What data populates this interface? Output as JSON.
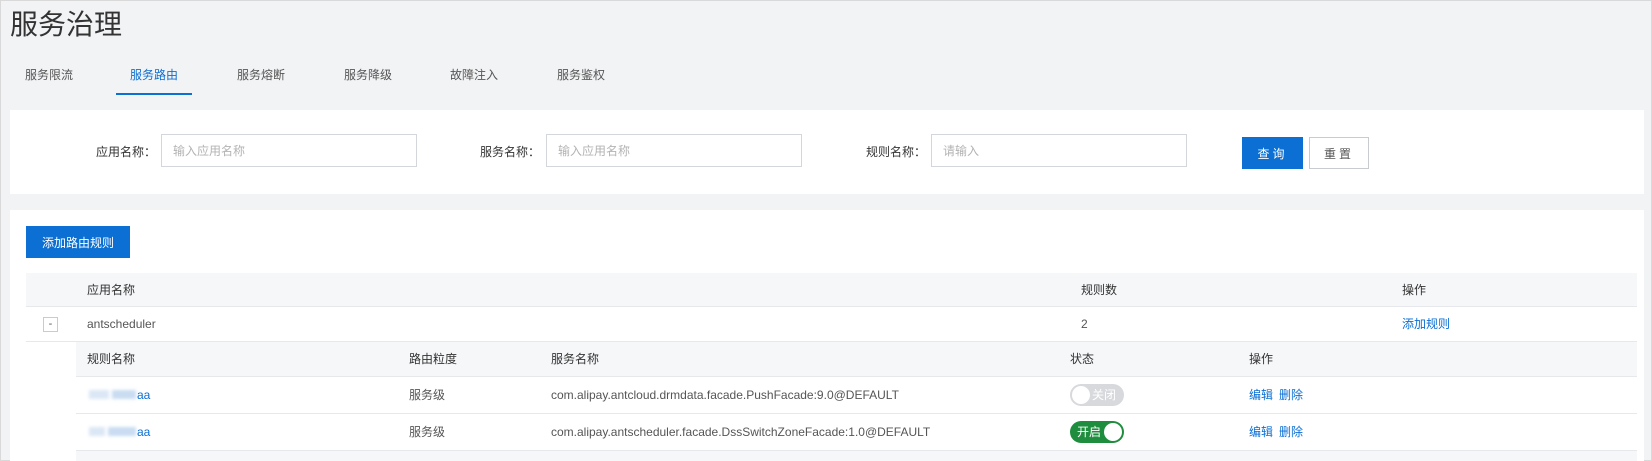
{
  "page": {
    "title": "服务治理"
  },
  "tabs": [
    {
      "label": "服务限流",
      "active": false
    },
    {
      "label": "服务路由",
      "active": true
    },
    {
      "label": "服务熔断",
      "active": false
    },
    {
      "label": "服务降级",
      "active": false
    },
    {
      "label": "故障注入",
      "active": false
    },
    {
      "label": "服务鉴权",
      "active": false
    }
  ],
  "filters": {
    "app_name": {
      "label": "应用名称：",
      "value": "",
      "placeholder": "输入应用名称"
    },
    "service_name": {
      "label": "服务名称：",
      "value": "",
      "placeholder": "输入应用名称"
    },
    "rule_name": {
      "label": "规则名称：",
      "value": "",
      "placeholder": "请输入"
    },
    "query_label": "查询",
    "reset_label": "重置"
  },
  "toolbar": {
    "add_rule_label": "添加路由规则"
  },
  "table": {
    "columns": {
      "app_name": "应用名称",
      "rule_count": "规则数",
      "actions": "操作"
    },
    "rows": [
      {
        "expand_symbol": "-",
        "app_name": "antscheduler",
        "rule_count": "2",
        "action": "添加规则"
      }
    ]
  },
  "sub_table": {
    "columns": {
      "rule_name": "规则名称",
      "granularity": "路由粒度",
      "service_name": "服务名称",
      "status": "状态",
      "actions": "操作"
    },
    "rows": [
      {
        "rule_name_suffix": "aa",
        "granularity": "服务级",
        "service_name": "com.alipay.antcloud.drmdata.facade.PushFacade:9.0@DEFAULT",
        "status": "off",
        "status_label": "关闭",
        "edit": "编辑",
        "delete": "删除"
      },
      {
        "rule_name_suffix": "aa",
        "granularity": "服务级",
        "service_name": "com.alipay.antscheduler.facade.DssSwitchZoneFacade:1.0@DEFAULT",
        "status": "on",
        "status_label": "开启",
        "edit": "编辑",
        "delete": "删除"
      }
    ]
  },
  "colors": {
    "accent": "#0b6fd3",
    "toggle_on": "#1e8e3e",
    "toggle_off": "#d7d9dc"
  }
}
